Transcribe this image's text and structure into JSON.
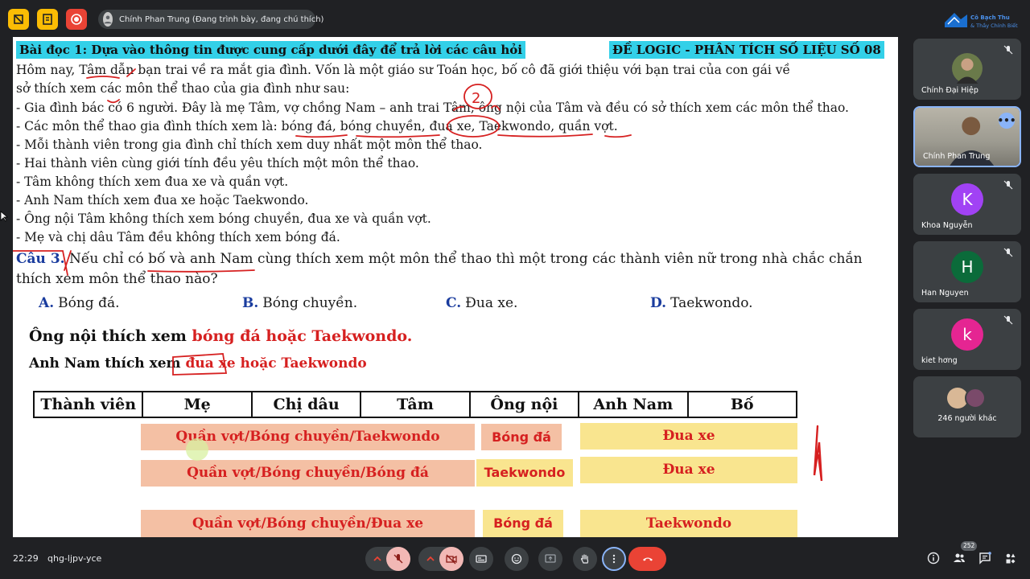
{
  "topbar": {
    "presenter": "Chính Phan Trung (Đang trình bày, đang chú thích)",
    "brand": [
      "Cô Bạch Thu",
      "& Thầy Chính Biết"
    ]
  },
  "slide": {
    "title": "Bài đọc 1: Dựa vào thông tin được cung cấp dưới đây để trả lời các câu hỏi",
    "title_right": "ĐỀ LOGIC - PHÂN TÍCH SỐ LIỆU SỐ 08",
    "paragraphs": [
      "Hôm nay, Tâm dẫn bạn trai về ra mắt gia đình. Vốn là một giáo sư Toán học, bố cô đã giới thiệu với bạn trai của con gái về",
      "sở thích xem các môn thể thao của gia đình như sau:",
      "- Gia đình bác có 6 người. Đây là mẹ Tâm, vợ chồng Nam – anh trai Tâm, ông nội của Tâm và đều có sở thích xem các môn thể thao.",
      "- Các môn thể thao gia đình thích xem là: bóng đá, bóng chuyền, đua xe, Taekwondo, quần vợt.",
      "- Mỗi thành viên trong gia đình chỉ thích xem duy nhất một môn thể thao.",
      "- Hai thành viên cùng giới tính đều yêu thích một môn thể thao.",
      "- Tâm không thích xem đua xe và quần vợt.",
      "- Anh Nam thích xem đua xe hoặc Taekwondo.",
      "- Ông nội Tâm không thích xem bóng chuyền, đua xe và quần vợt.",
      "- Mẹ và chị dâu Tâm đều không thích xem bóng đá."
    ],
    "question_label": "Câu 3.",
    "question_line1": " Nếu chỉ có bố và anh Nam cùng thích xem một môn thể thao thì một trong các thành viên nữ trong nhà chắc chắn",
    "question_line2": "thích xem môn thể thao nào?",
    "options": [
      {
        "key": "A.",
        "text": "Bóng đá."
      },
      {
        "key": "B.",
        "text": "Bóng chuyền."
      },
      {
        "key": "C.",
        "text": "Đua xe."
      },
      {
        "key": "D.",
        "text": "Taekwondo."
      }
    ],
    "note1_prefix": "Ông nội thích xem ",
    "note1_red": "bóng đá hoặc Taekwondo.",
    "note2_prefix": "Anh Nam thích xem ",
    "note2_red": "đua xe hoặc Taekwondo",
    "table_headers": [
      "Thành viên",
      "Mẹ",
      "Chị dâu",
      "Tâm",
      "Ông nội",
      "Anh Nam",
      "Bố"
    ],
    "rows": [
      {
        "women": "Quần vợt/Bóng chuyền/Taekwondo",
        "grandpa": "Bóng đá",
        "nam_dad": "Đua xe"
      },
      {
        "women": "Quần vợt/Bóng chuyền/Bóng đá",
        "grandpa": "Taekwondo",
        "nam_dad": "Đua xe"
      },
      {
        "women": "Quần vợt/Bóng chuyền/Đua xe",
        "grandpa": "Bóng đá",
        "nam_dad": "Taekwondo"
      }
    ],
    "annotation_number": "2"
  },
  "participants": [
    {
      "name": "Chính Đại Hiệp",
      "initial": "",
      "color": "#5f6368"
    },
    {
      "name": "Chính Phan Trung",
      "initial": "",
      "color": "#5f6368"
    },
    {
      "name": "Khoa Nguyễn",
      "initial": "K",
      "color": "#a142f4"
    },
    {
      "name": "Han Nguyen",
      "initial": "H",
      "color": "#0b6b3a"
    },
    {
      "name": "kiet hơng",
      "initial": "k",
      "color": "#e52592"
    },
    {
      "name": "246 người khác",
      "initial": "",
      "color": "#5f6368"
    }
  ],
  "bottombar": {
    "time": "22:29",
    "meeting_code": "qhg-ljpv-yce",
    "people_count": "252"
  },
  "colors": {
    "highlight": "#33d0e8",
    "answer_red": "#d62020",
    "salmon": "#f4c0a4",
    "yellow": "#f9e58f",
    "end_call": "#ea4335"
  }
}
